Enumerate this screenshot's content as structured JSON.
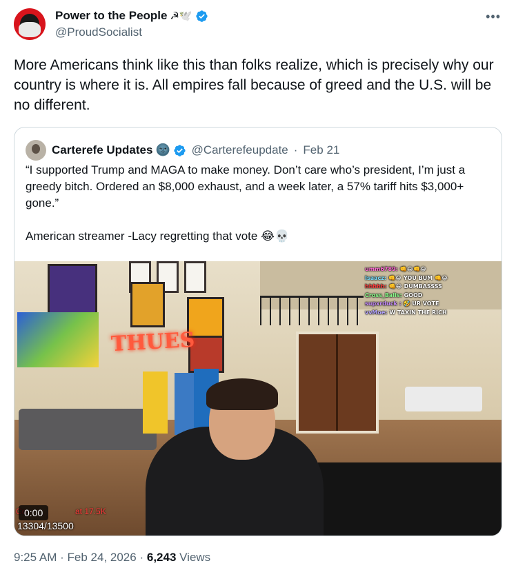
{
  "author": {
    "display_name": "Power to the People",
    "name_emojis": "☭🕊️",
    "handle": "@ProudSocialist"
  },
  "tweet": {
    "text": "More Americans think like this than folks realize, which is precisely why our country is where it is. All empires fall because of greed and the U.S. will be no different.",
    "time": "9:25 AM",
    "date": "Feb 24, 2026",
    "views_count": "6,243",
    "views_label": "Views"
  },
  "quote": {
    "display_name": "Carterefe Updates",
    "name_emoji": "🌚",
    "handle": "@Carterefeupdate",
    "date": "Feb 21",
    "text_line1": "“I supported Trump and MAGA to make money. Don’t care who’s president, I’m just a greedy bitch. Ordered an $8,000 exhaust, and a week later, a 57% tariff hits $3,000+ gone.”",
    "text_line2": "American streamer -Lacy regretting that vote 😂💀",
    "video": {
      "time": "0:00",
      "left_overlay": "Co",
      "goal_text": "at 17.5K",
      "counter": "13304/13500",
      "neon_sign": "THUES",
      "chat": [
        {
          "user": "umm6789:",
          "msg": "👊😂👊😂"
        },
        {
          "user": "Isaacz:",
          "msg": "👊😂 YOU BUM 👊😂"
        },
        {
          "user": "hhhhh:",
          "msg": "👊😂 DUMBASSSS"
        },
        {
          "user": "Cross_Balls:",
          "msg": "GOOD"
        },
        {
          "user": "supxrduck :",
          "msg": "🤣 UR VOTE"
        },
        {
          "user": "vvMoe:",
          "msg": "W TAXIN THE RICH"
        }
      ]
    }
  },
  "colors": {
    "text": "#0f1419",
    "secondary": "#536471",
    "verified": "#1d9bf0",
    "border": "#cfd9de"
  }
}
